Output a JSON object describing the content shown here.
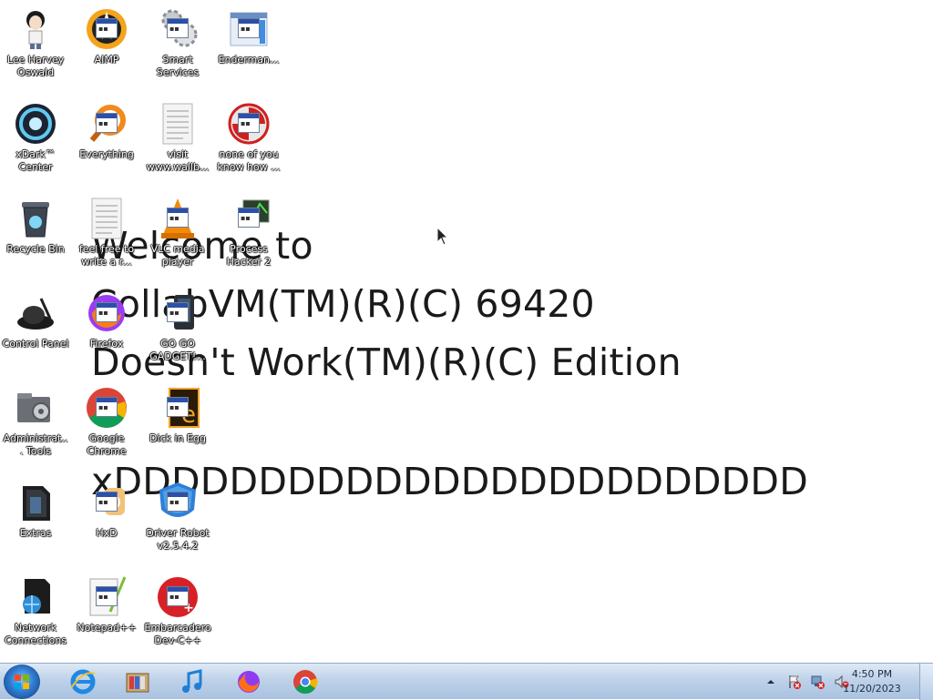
{
  "wallpaper": {
    "line1": "Welcome to",
    "line2": "CollabVM(TM)(R)(C) 69420",
    "line3": "Doesn't Work(TM)(R)(C) Edition",
    "line4": "xDDDDDDDDDDDDDDDDDDDDDDDD"
  },
  "desktop_icons": [
    {
      "label": "Lee Harvey Oswald",
      "icon": "character-icon"
    },
    {
      "label": "AIMP",
      "icon": "aimp-icon"
    },
    {
      "label": "Smart Services",
      "icon": "gears-icon"
    },
    {
      "label": "Enderman...",
      "icon": "window-icon"
    },
    {
      "label": "xDark™ Center",
      "icon": "xdark-icon"
    },
    {
      "label": "Everything",
      "icon": "everything-icon"
    },
    {
      "label": "visit www.wallb...",
      "icon": "text-document-icon"
    },
    {
      "label": "none of you know how ...",
      "icon": "red-swirl-icon"
    },
    {
      "label": "Recycle Bin",
      "icon": "recycle-bin-icon"
    },
    {
      "label": "feel free to write a r...",
      "icon": "text-document-icon"
    },
    {
      "label": "VLC media player",
      "icon": "vlc-icon"
    },
    {
      "label": "Process Hacker 2",
      "icon": "process-hacker-icon"
    },
    {
      "label": "Control Panel",
      "icon": "control-panel-icon"
    },
    {
      "label": "Firefox",
      "icon": "firefox-icon"
    },
    {
      "label": "GO GO GADGET!...",
      "icon": "gadget-icon"
    },
    {
      "label": "Administrat... Tools",
      "icon": "admin-tools-icon"
    },
    {
      "label": "Google Chrome",
      "icon": "chrome-icon"
    },
    {
      "label": "Dick in Egg",
      "icon": "egg-icon"
    },
    {
      "label": "Extras",
      "icon": "folder-icon"
    },
    {
      "label": "HxD",
      "icon": "hxd-icon"
    },
    {
      "label": "Driver Robot v2.5.4.2",
      "icon": "driver-robot-icon"
    },
    {
      "label": "Network Connections",
      "icon": "network-icon"
    },
    {
      "label": "Notepad++",
      "icon": "notepadpp-icon"
    },
    {
      "label": "Embarcadero Dev-C++",
      "icon": "devcpp-icon"
    }
  ],
  "taskbar": {
    "pinned": [
      {
        "name": "Internet Explorer",
        "icon": "internet-explorer-icon"
      },
      {
        "name": "Explorer",
        "icon": "library-icon"
      },
      {
        "name": "Media",
        "icon": "music-note-icon"
      },
      {
        "name": "Firefox",
        "icon": "firefox-icon"
      },
      {
        "name": "Google Chrome",
        "icon": "chrome-icon"
      }
    ],
    "clock": {
      "time": "4:50 PM",
      "date": "11/20/2023"
    }
  }
}
